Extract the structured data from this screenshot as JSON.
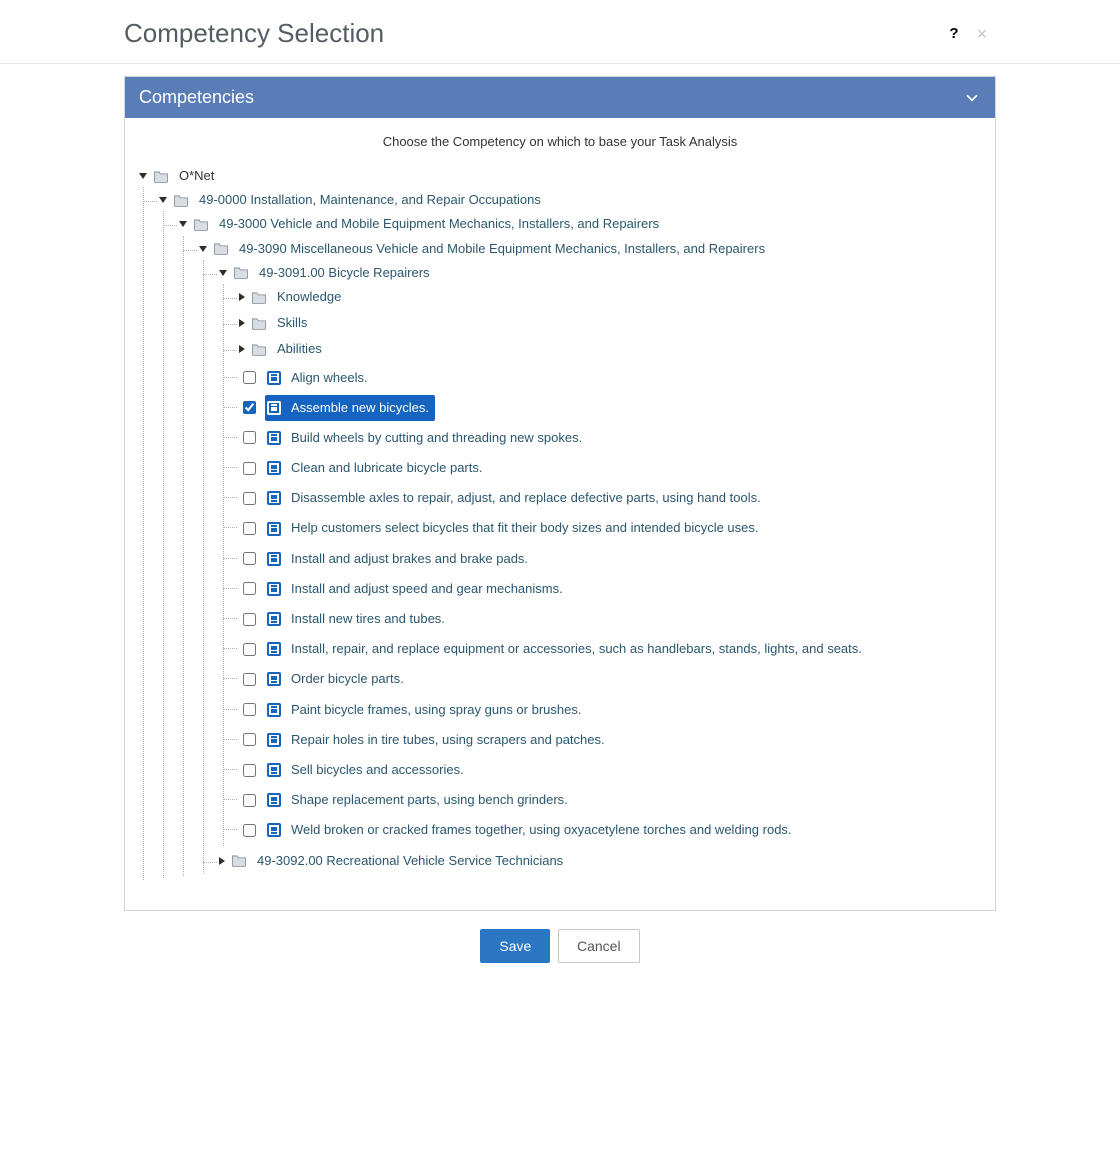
{
  "dialog": {
    "title": "Competency Selection",
    "help_icon": "?",
    "close_icon": "×"
  },
  "panel": {
    "title": "Competencies",
    "instruction": "Choose the Competency on which to base your Task Analysis"
  },
  "tree": {
    "root": {
      "label": "O*Net",
      "expanded": true,
      "children": [
        {
          "label": "49-0000 Installation, Maintenance, and Repair Occupations",
          "expanded": true,
          "children": [
            {
              "label": "49-3000 Vehicle and Mobile Equipment Mechanics, Installers, and Repairers",
              "expanded": true,
              "children": [
                {
                  "label": "49-3090 Miscellaneous Vehicle and Mobile Equipment Mechanics, Installers, and Repairers",
                  "expanded": true,
                  "children": [
                    {
                      "label": "49-3091.00 Bicycle Repairers",
                      "expanded": true,
                      "children": [
                        {
                          "label": "Knowledge",
                          "type": "folder",
                          "expanded": false
                        },
                        {
                          "label": "Skills",
                          "type": "folder",
                          "expanded": false
                        },
                        {
                          "label": "Abilities",
                          "type": "folder",
                          "expanded": false
                        },
                        {
                          "label": "Align wheels.",
                          "type": "leaf",
                          "checked": false
                        },
                        {
                          "label": "Assemble new bicycles.",
                          "type": "leaf",
                          "checked": true,
                          "selected": true
                        },
                        {
                          "label": "Build wheels by cutting and threading new spokes.",
                          "type": "leaf",
                          "checked": false
                        },
                        {
                          "label": "Clean and lubricate bicycle parts.",
                          "type": "leaf",
                          "checked": false
                        },
                        {
                          "label": "Disassemble axles to repair, adjust, and replace defective parts, using hand tools.",
                          "type": "leaf",
                          "checked": false
                        },
                        {
                          "label": "Help customers select bicycles that fit their body sizes and intended bicycle uses.",
                          "type": "leaf",
                          "checked": false
                        },
                        {
                          "label": "Install and adjust brakes and brake pads.",
                          "type": "leaf",
                          "checked": false
                        },
                        {
                          "label": "Install and adjust speed and gear mechanisms.",
                          "type": "leaf",
                          "checked": false
                        },
                        {
                          "label": "Install new tires and tubes.",
                          "type": "leaf",
                          "checked": false
                        },
                        {
                          "label": "Install, repair, and replace equipment or accessories, such as handlebars, stands, lights, and seats.",
                          "type": "leaf",
                          "checked": false
                        },
                        {
                          "label": "Order bicycle parts.",
                          "type": "leaf",
                          "checked": false
                        },
                        {
                          "label": "Paint bicycle frames, using spray guns or brushes.",
                          "type": "leaf",
                          "checked": false
                        },
                        {
                          "label": "Repair holes in tire tubes, using scrapers and patches.",
                          "type": "leaf",
                          "checked": false
                        },
                        {
                          "label": "Sell bicycles and accessories.",
                          "type": "leaf",
                          "checked": false
                        },
                        {
                          "label": "Shape replacement parts, using bench grinders.",
                          "type": "leaf",
                          "checked": false
                        },
                        {
                          "label": "Weld broken or cracked frames together, using oxyacetylene torches and welding rods.",
                          "type": "leaf",
                          "checked": false
                        }
                      ]
                    },
                    {
                      "label": "49-3092.00 Recreational Vehicle Service Technicians",
                      "expanded": false,
                      "type": "folder"
                    }
                  ]
                }
              ]
            }
          ]
        }
      ]
    }
  },
  "footer": {
    "save": "Save",
    "cancel": "Cancel"
  }
}
